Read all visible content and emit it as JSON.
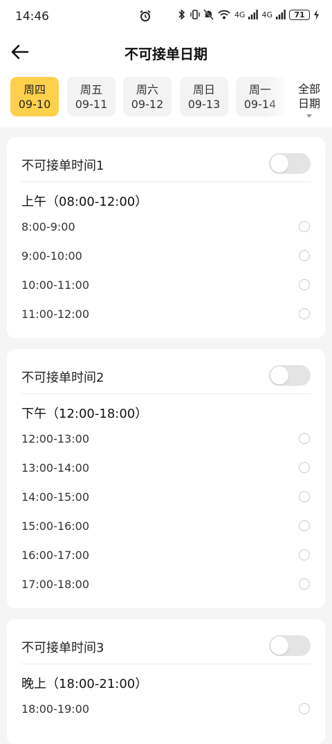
{
  "status_bar": {
    "time": "14:46",
    "signal_label_1": "4G",
    "signal_label_2": "4G",
    "battery": "71"
  },
  "header": {
    "title": "不可接单日期"
  },
  "date_tabs": [
    {
      "weekday": "周四",
      "date": "09-10"
    },
    {
      "weekday": "周五",
      "date": "09-11"
    },
    {
      "weekday": "周六",
      "date": "09-12"
    },
    {
      "weekday": "周日",
      "date": "09-13"
    },
    {
      "weekday": "周一",
      "date": "09-14"
    }
  ],
  "all_dates": {
    "line1": "全部",
    "line2": "日期"
  },
  "cards": [
    {
      "title": "不可接单时间1",
      "enabled": false,
      "period": "上午（08:00-12:00）",
      "slots": [
        "8:00-9:00",
        "9:00-10:00",
        "10:00-11:00",
        "11:00-12:00"
      ]
    },
    {
      "title": "不可接单时间2",
      "enabled": false,
      "period": "下午（12:00-18:00）",
      "slots": [
        "12:00-13:00",
        "13:00-14:00",
        "14:00-15:00",
        "15:00-16:00",
        "16:00-17:00",
        "17:00-18:00"
      ]
    },
    {
      "title": "不可接单时间3",
      "enabled": false,
      "period": "晚上（18:00-21:00）",
      "slots": [
        "18:00-19:00"
      ]
    }
  ],
  "colors": {
    "accent": "#ffd04b",
    "background": "#f5f5f5"
  }
}
